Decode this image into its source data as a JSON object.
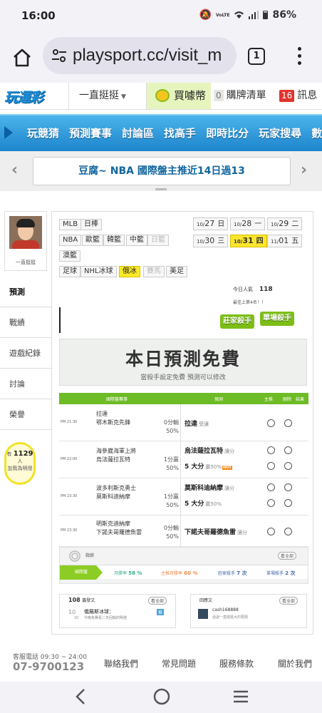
{
  "status_bar": {
    "time": "16:00",
    "battery": "86%",
    "volte": "VoLTE"
  },
  "browser": {
    "url": "playsport.cc/visit_m",
    "tab_count": "1"
  },
  "site_header": {
    "logo": "玩運彩",
    "follow_menu": "一直挺挺",
    "buy_coin": "買噱幣",
    "buy_list_count": "0",
    "buy_list": "購牌清單",
    "message_count": "16",
    "messages": "訊息"
  },
  "nav": {
    "items": [
      "玩競猜",
      "預測賽事",
      "討論區",
      "找高手",
      "即時比分",
      "玩家搜尋",
      "數據"
    ]
  },
  "announcement": {
    "text": "豆腐~ NBA 國際盤主推近14日過13"
  },
  "profile": {
    "name": "一直挺挺"
  },
  "side_tabs": [
    "預測",
    "戰績",
    "遊戲紀錄",
    "討論",
    "榮譽"
  ],
  "likes": {
    "prefix": "有",
    "count": "1129",
    "unit": "人",
    "suffix": "加我為明燈"
  },
  "league_tags": [
    {
      "label": "MLB",
      "state": "normal"
    },
    {
      "label": "日棒",
      "state": "normal"
    },
    {
      "label": "NBA",
      "state": "normal"
    },
    {
      "label": "歐籃",
      "state": "normal"
    },
    {
      "label": "韓籃",
      "state": "normal"
    },
    {
      "label": "中籃",
      "state": "normal"
    },
    {
      "label": "日籃",
      "state": "disabled"
    },
    {
      "label": "澳籃",
      "state": "normal"
    },
    {
      "label": "足球",
      "state": "normal"
    },
    {
      "label": "NHL冰球",
      "state": "normal"
    },
    {
      "label": "俄冰",
      "state": "selected"
    },
    {
      "label": "賽馬",
      "state": "disabled"
    },
    {
      "label": "美足",
      "state": "normal"
    }
  ],
  "dates": [
    {
      "month": "10/",
      "day": "27",
      "dow": "日",
      "selected": false
    },
    {
      "month": "10/",
      "day": "28",
      "dow": "一",
      "selected": false
    },
    {
      "month": "10/",
      "day": "29",
      "dow": "二",
      "selected": false
    },
    {
      "month": "10/",
      "day": "30",
      "dow": "三",
      "selected": false
    },
    {
      "month": "10/",
      "day": "31",
      "dow": "四",
      "selected": true
    },
    {
      "month": "11/",
      "day": "01",
      "dow": "五",
      "selected": false
    }
  ],
  "today_popularity": {
    "label": "今日人氣",
    "value": "118"
  },
  "rank_line": "最佳上第4名！！",
  "killers": [
    "莊家殺手",
    "單場殺手"
  ],
  "free_banner": {
    "title": "本日預測免費",
    "subtitle": "當殺手設定免費 預測可以修改"
  },
  "table": {
    "headers": {
      "game": "國際盤賽事",
      "prediction": "預測",
      "main": "主推",
      "delete": "刪除",
      "result": "結果"
    },
    "rows": [
      {
        "time": "PM 21:30",
        "teams": [
          "拉達",
          "鄂木斯克先鋒"
        ],
        "odds": [
          "0分輸",
          "50%"
        ],
        "picks": [
          {
            "team": "拉達",
            "note": "受讓",
            "hot": false
          }
        ]
      },
      {
        "time": "PM 22:00",
        "teams": [
          "海參崴海軍上將",
          "烏法薩拉瓦特"
        ],
        "odds": [
          "1分贏",
          "50%"
        ],
        "picks": [
          {
            "team": "烏法薩拉瓦特",
            "note": "讓分",
            "hot": false
          },
          {
            "team": "5 大分",
            "note": "贏50%",
            "hot": true
          }
        ]
      },
      {
        "time": "PM 23:30",
        "teams": [
          "波多利斯克勇士",
          "莫斯科迪納摩"
        ],
        "odds": [
          "1分贏",
          "50%"
        ],
        "picks": [
          {
            "team": "莫斯科迪納摩",
            "note": "讓分",
            "hot": false
          },
          {
            "team": "5 大分",
            "note": "贏50%",
            "hot": false
          }
        ]
      },
      {
        "time": "PM 23:30",
        "teams": [
          "明斯克迪納摩",
          "下諾夫哥羅德魚雷"
        ],
        "odds": [
          "0分輸",
          "50%"
        ],
        "picks": [
          {
            "team": "下諾夫哥羅德魚雷",
            "note": "讓分",
            "hot": false
          }
        ]
      }
    ]
  },
  "record": {
    "label": "戰績",
    "more": "看全部",
    "tab": "國際盤",
    "stats": [
      {
        "label": "月勝率",
        "value": "58 %"
      },
      {
        "label": "主推月勝率",
        "value": "60 %"
      },
      {
        "label": "莊家殺手",
        "value": "7 次"
      },
      {
        "label": "單場殺手",
        "value": "2 次"
      }
    ]
  },
  "posts": {
    "count": "108",
    "label": "篇發文",
    "more": "看全部",
    "item_num": "10",
    "item_sub": "30",
    "item_title": "俄羅斯冰球：",
    "item_desc": "今晚免費看二天回鍋的明燈",
    "badge": "推"
  },
  "replies": {
    "label": "回應文",
    "more": "看全部",
    "user": "cash168888",
    "text": "話說一直挺挺大的預測"
  },
  "footer": {
    "service": "客服電話 09:30 ~ 24:00",
    "phone": "07-9700123",
    "links": [
      "聯絡我們",
      "常見問題",
      "服務條款",
      "關於我們"
    ]
  }
}
